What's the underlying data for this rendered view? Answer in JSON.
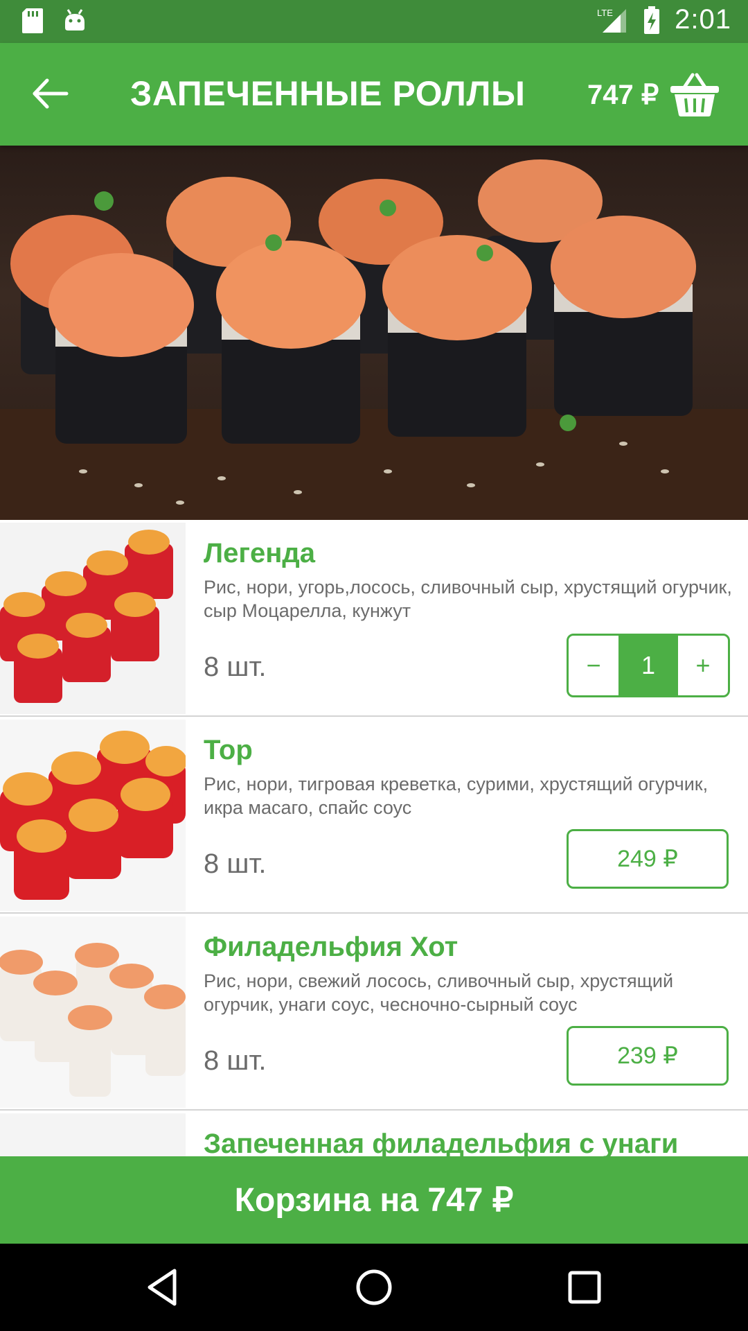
{
  "status_bar": {
    "time": "2:01",
    "network": "LTE"
  },
  "app_bar": {
    "title": "ЗАПЕЧЕННЫЕ РОЛЛЫ",
    "cart_total": "747 ₽",
    "icons": [
      "back-arrow-icon",
      "basket-icon"
    ]
  },
  "hero_image": "baked-rolls-photo",
  "products": [
    {
      "name": "Легенда",
      "description": "Рис, нори, угорь,лосось, сливочный сыр, хрустящий огурчик, сыр Моцарелла, кунжут",
      "pieces": "8 шт.",
      "in_cart": true,
      "quantity": "1",
      "minus": "−",
      "plus": "+"
    },
    {
      "name": "Тор",
      "description": "Рис, нори, тигровая креветка, сурими, хрустящий огурчик, икра масаго, спайс соус",
      "pieces": "8 шт.",
      "in_cart": false,
      "price": "249 ₽"
    },
    {
      "name": "Филадельфия Хот",
      "description": "Рис, нори, свежий лосось, сливочный сыр, хрустящий огурчик, унаги соус, чесночно-сырный соус",
      "pieces": "8 шт.",
      "in_cart": false,
      "price": "239 ₽"
    },
    {
      "name": "Запеченная филадельфия с унаги"
    }
  ],
  "cart_button": {
    "label": "Корзина на 747 ₽"
  },
  "colors": {
    "primary": "#4caf45",
    "status_bar": "#3f8c3a",
    "text_gray": "#6b6b6b"
  }
}
